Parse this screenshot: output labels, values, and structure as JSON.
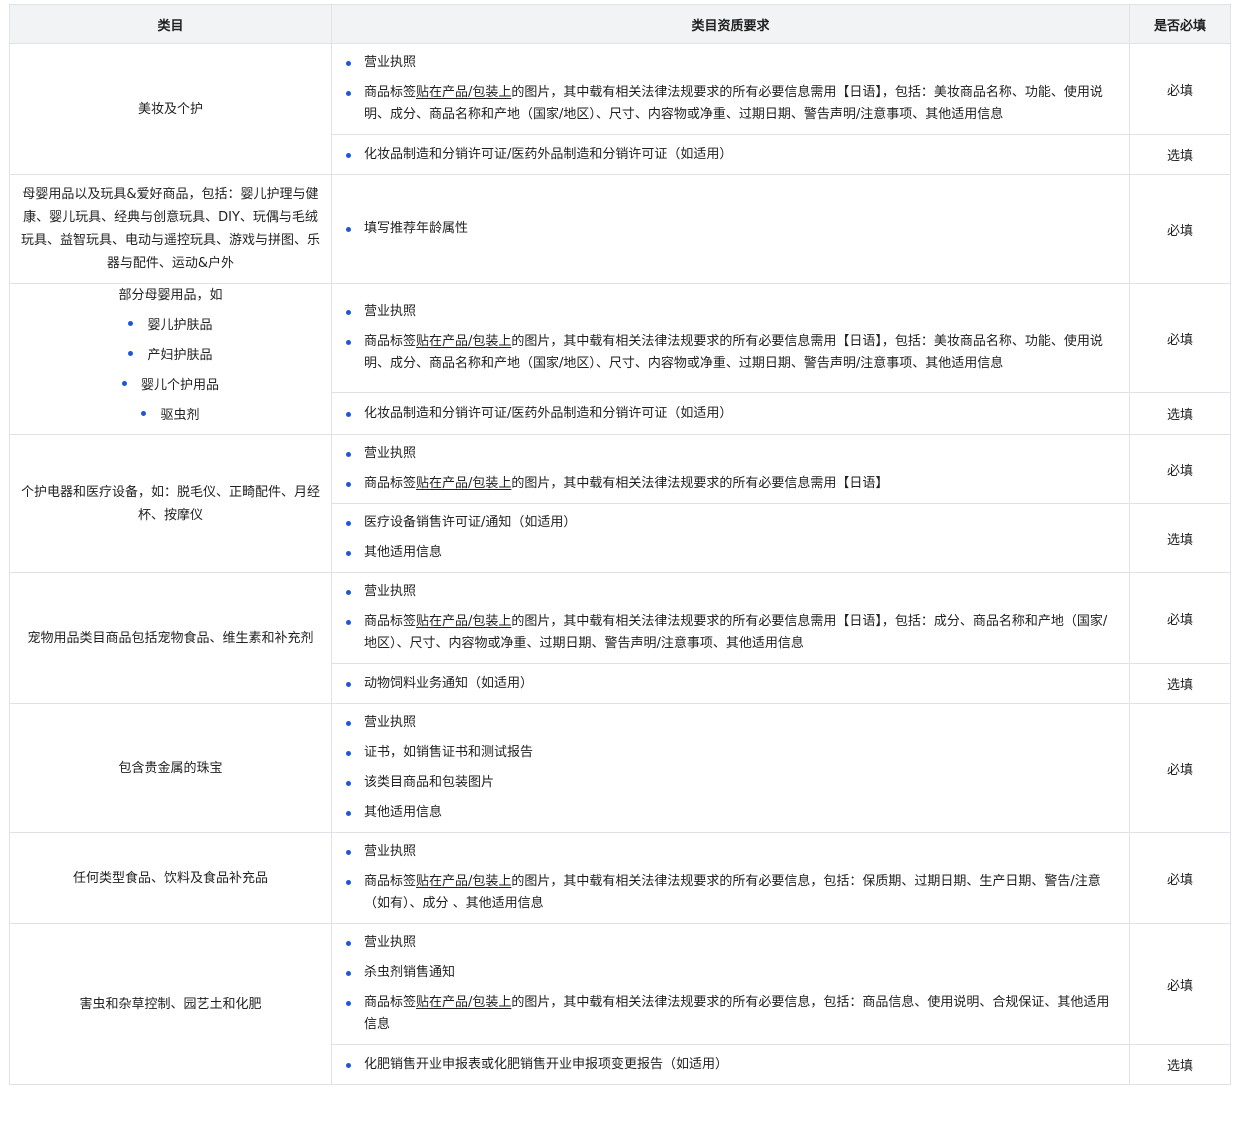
{
  "header": {
    "col1": "类目",
    "col2": "类目资质要求",
    "col3": "是否必填"
  },
  "common": {
    "business_license": "营业执照",
    "required": "必填",
    "optional": "选填",
    "other_info": "其他适用信息",
    "label_pre": "商品标签",
    "label_link": "贴在产品/包装上",
    "label_post": "的图片，其中载有相关法律法规要求的所有必要信息",
    "cosmetics_permit": "化妆品制造和分销许可证/医药外品制造和分销许可证（如适用）"
  },
  "beauty": {
    "category": "美妆及个护",
    "label_rest": "需用【日语】，包括：美妆商品名称、功能、使用说明、成分、商品名称和产地（国家/地区）、尺寸、内容物或净重、过期日期、警告声明/注意事项、其他适用信息"
  },
  "baby_toys": {
    "category": "母婴用品以及玩具&爱好商品，包括：婴儿护理与健康、婴儿玩具、经典与创意玩具、DIY、玩偶与毛绒玩具、益智玩具、电动与遥控玩具、游戏与拼图、乐器与配件、运动&户外",
    "req": "填写推荐年龄属性"
  },
  "baby_partial": {
    "category": "部分母婴用品，如",
    "sub_items": [
      "婴儿护肤品",
      "产妇护肤品",
      "婴儿个护用品",
      "驱虫剂"
    ],
    "label_rest": "需用【日语】，包括：美妆商品名称、功能、使用说明、成分、商品名称和产地（国家/地区）、尺寸、内容物或净重、过期日期、警告声明/注意事项、其他适用信息"
  },
  "devices": {
    "category": "个护电器和医疗设备，如：脱毛仪、正畸配件、月经杯、按摩仪",
    "label_rest": "需用【日语】",
    "medical_permit": "医疗设备销售许可证/通知（如适用）"
  },
  "pet": {
    "category": "宠物用品类目商品包括宠物食品、维生素和补充剂",
    "label_rest": "需用【日语】，包括：成分、商品名称和产地（国家/地区）、尺寸、内容物或净重、过期日期、警告声明/注意事项、其他适用信息",
    "feed_notice": "动物饲料业务通知（如适用）"
  },
  "jewelry": {
    "category": "包含贵金属的珠宝",
    "certificate": "证书，如销售证书和测试报告",
    "images": "该类目商品和包装图片"
  },
  "food": {
    "category": "任何类型食品、饮料及食品补充品",
    "label_rest": "，包括：保质期、过期日期、生产日期、警告/注意（如有）、成分 、其他适用信息"
  },
  "pest": {
    "category": "害虫和杂草控制、园艺土和化肥",
    "pesticide_notice": "杀虫剂销售通知",
    "label_rest": "，包括：商品信息、使用说明、合规保证、其他适用信息",
    "fertilizer_report": "化肥销售开业申报表或化肥销售开业申报项变更报告（如适用）"
  }
}
